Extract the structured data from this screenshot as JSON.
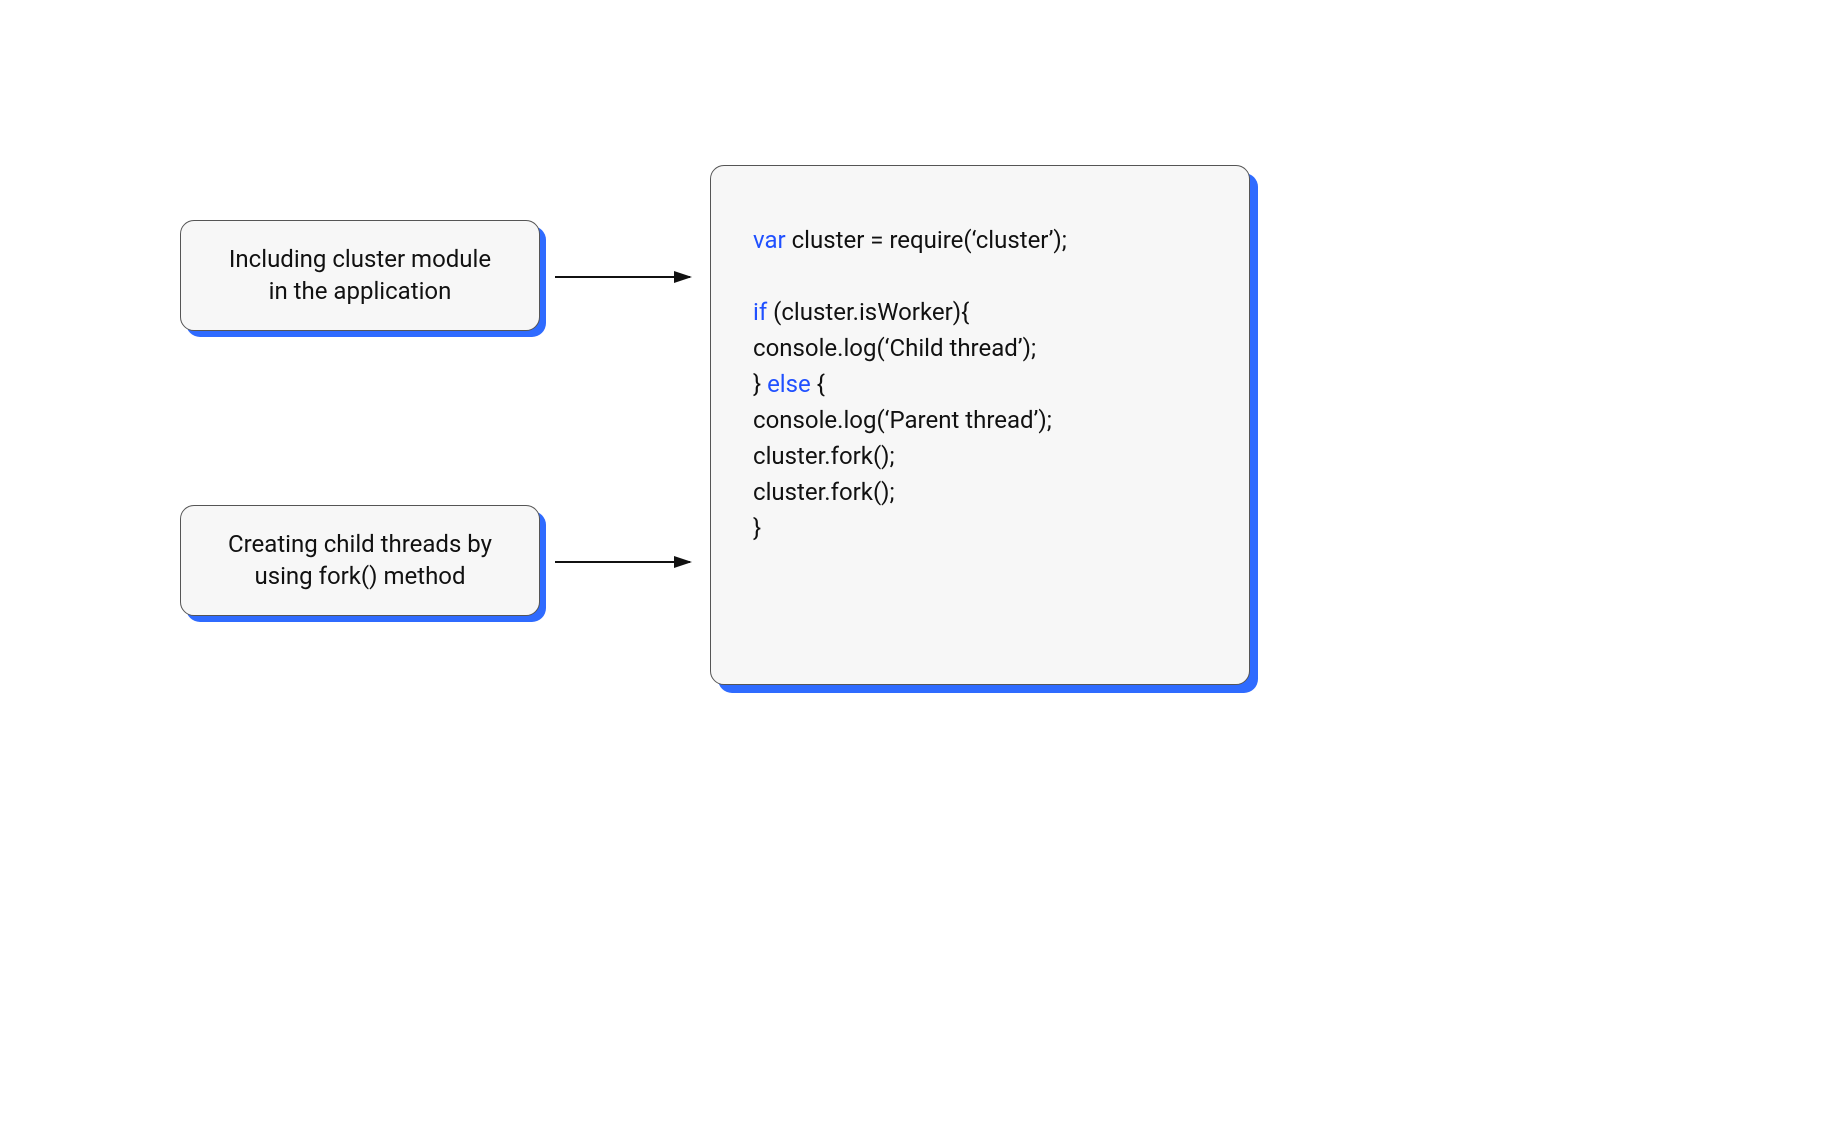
{
  "labels": {
    "top_line1": "Including cluster module",
    "top_line2": "in the application",
    "bottom_line1": "Creating child threads by",
    "bottom_line2": "using fork() method"
  },
  "code": {
    "kw_var": "var",
    "line1_rest": " cluster = require(‘cluster’);",
    "blank": "",
    "kw_if": "if",
    "line2_rest": " (cluster.isWorker){",
    "line3": "console.log(‘Child thread’);",
    "line4_prefix": "} ",
    "kw_else": "else",
    "line4_suffix": " {",
    "line5": "console.log(‘Parent thread’);",
    "line6": "cluster.fork();",
    "line7": "cluster.fork();",
    "line8": "}"
  },
  "colors": {
    "accent": "#2f6bff",
    "keyword": "#2050ff",
    "box_bg": "#f7f7f7",
    "border": "#555555"
  }
}
